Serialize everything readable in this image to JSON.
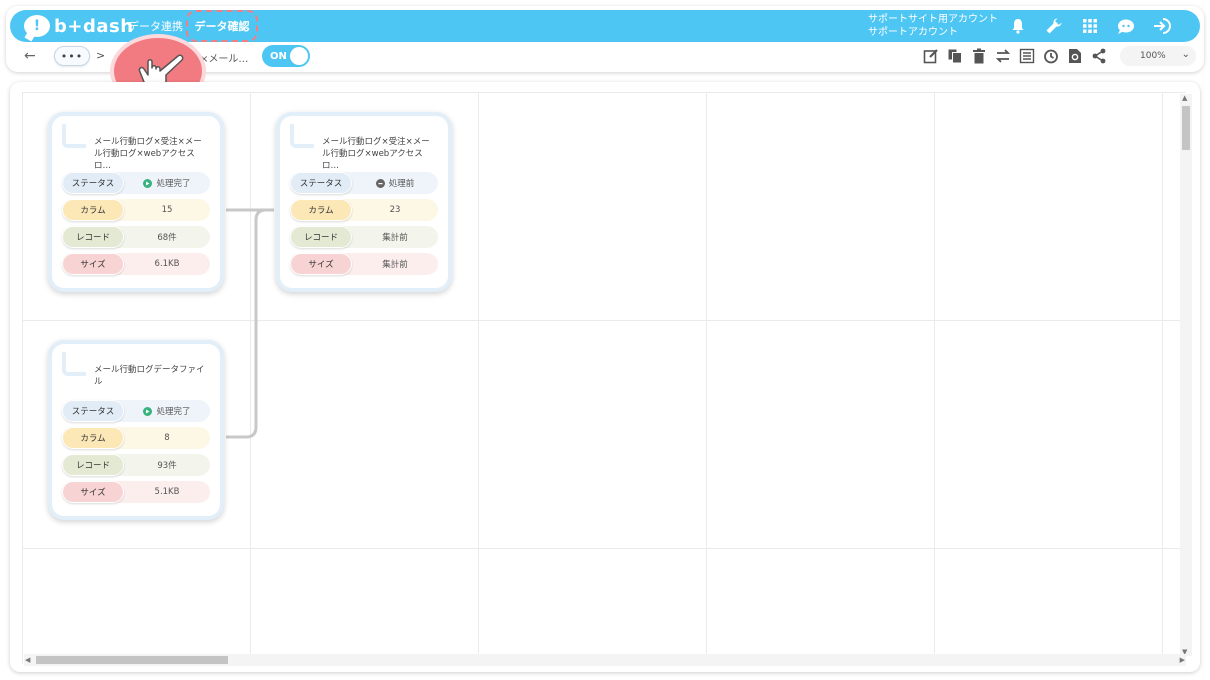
{
  "header": {
    "logo_mark": "!",
    "logo_text": "b+dash",
    "nav": [
      "データ連携",
      "データ確認"
    ],
    "account_line1": "サポートサイト用アカウント",
    "account_line2": "サポートアカウント"
  },
  "toolbar": {
    "back": "←",
    "ellipsis": "•••",
    "separator": ">",
    "breadcrumb": "×メール…",
    "toggle": "ON",
    "zoom": "100%",
    "zoom_chevron": "⌄"
  },
  "cards": [
    {
      "title": "メール行動ログ×受注×メール行動ログ×webアクセスロ…",
      "status": "処理完了",
      "columns": "15",
      "records": "68件",
      "size": "6.1KB"
    },
    {
      "title": "メール行動ログ×受注×メール行動ログ×webアクセスロ…",
      "status": "処理前",
      "columns": "23",
      "records": "集計前",
      "size": "集計前"
    },
    {
      "title": "メール行動ログデータファイル",
      "status": "処理完了",
      "columns": "8",
      "records": "93件",
      "size": "5.1KB"
    }
  ],
  "labels": {
    "status": "ステータス",
    "columns": "カラム",
    "records": "レコード",
    "size": "サイズ"
  },
  "colors": {
    "brand": "#4ec6f4",
    "highlight": "#f27b81",
    "done": "#36b37e",
    "pending": "#666666"
  }
}
